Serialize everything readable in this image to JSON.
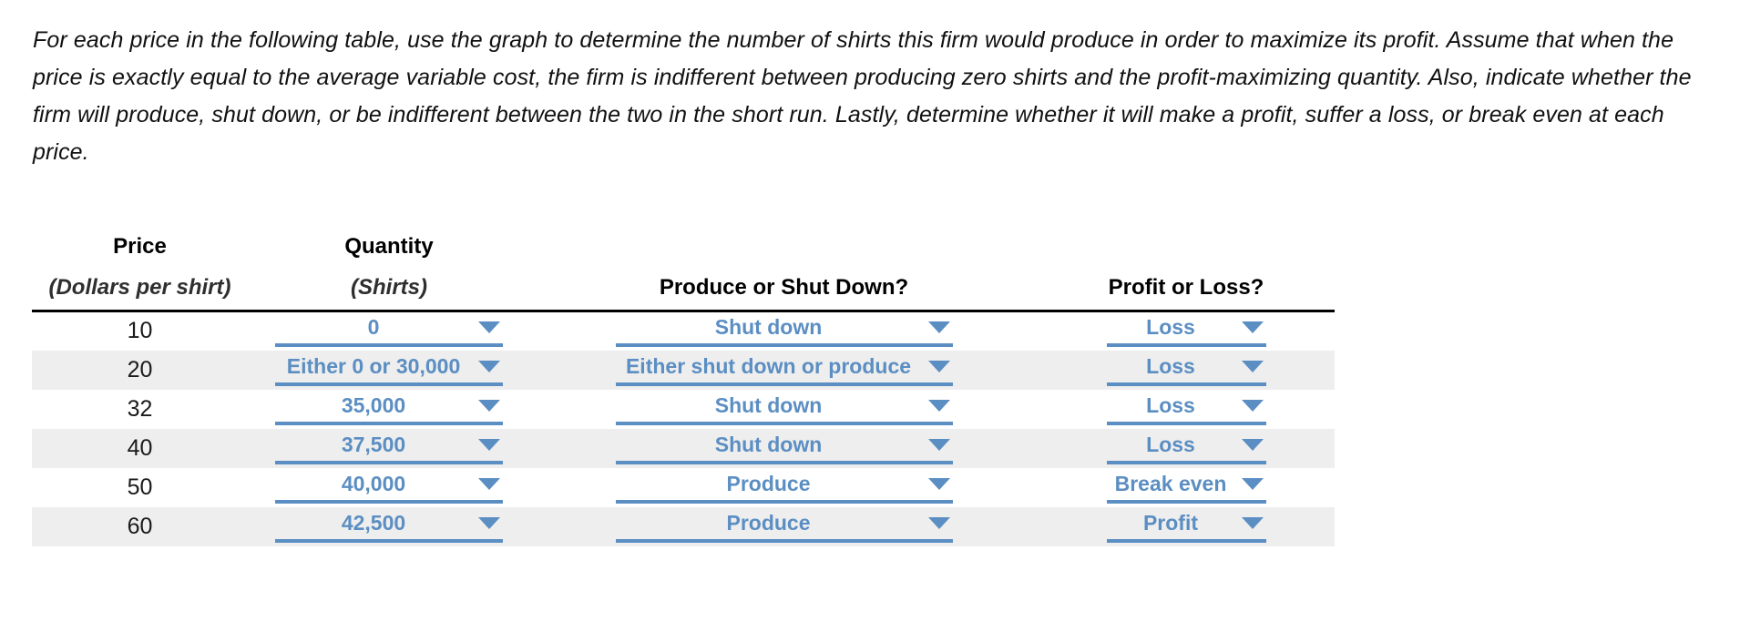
{
  "prompt": {
    "text": "For each price in the following table, use the graph to determine the number of shirts this firm would produce in order to maximize its profit. Assume that when the price is exactly equal to the average variable cost, the firm is indifferent between producing zero shirts and the profit-maximizing quantity. Also, indicate whether the firm will produce, shut down, or be indifferent between the two in the short run. Lastly, determine whether it will make a profit, suffer a loss, or break even at each price."
  },
  "table": {
    "headers": [
      {
        "line1": "Price",
        "line2": "(Dollars per shirt)"
      },
      {
        "line1": "Quantity",
        "line2": "(Shirts)"
      },
      {
        "line1": "",
        "line2": "Produce or Shut Down?"
      },
      {
        "line1": "",
        "line2": "Profit or Loss?"
      }
    ],
    "rows": [
      {
        "price": "10",
        "quantity": "0",
        "decision": "Shut down",
        "outcome": "Loss"
      },
      {
        "price": "20",
        "quantity": "Either 0 or 30,000",
        "decision": "Either shut down or produce",
        "outcome": "Loss"
      },
      {
        "price": "32",
        "quantity": "35,000",
        "decision": "Shut down",
        "outcome": "Loss"
      },
      {
        "price": "40",
        "quantity": "37,500",
        "decision": "Shut down",
        "outcome": "Loss"
      },
      {
        "price": "50",
        "quantity": "40,000",
        "decision": "Produce",
        "outcome": "Break even"
      },
      {
        "price": "60",
        "quantity": "42,500",
        "decision": "Produce",
        "outcome": "Profit"
      }
    ]
  },
  "colors": {
    "dropdown_blue": "#5b8ec2",
    "row_shade": "#eeeeee",
    "header_rule": "#000000",
    "header_subtext": "#2f2f2f"
  }
}
